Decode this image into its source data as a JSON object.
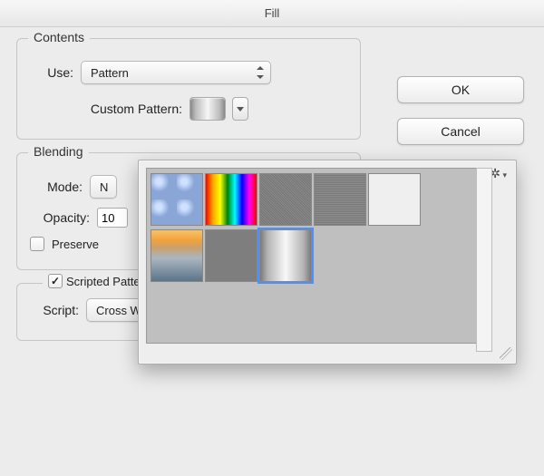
{
  "window": {
    "title": "Fill"
  },
  "buttons": {
    "ok": "OK",
    "cancel": "Cancel"
  },
  "contents": {
    "legend": "Contents",
    "use_label": "Use:",
    "use_value": "Pattern",
    "custom_pattern_label": "Custom Pattern:"
  },
  "blending": {
    "legend": "Blending",
    "mode_label": "Mode:",
    "mode_value_visible": "N",
    "opacity_label": "Opacity:",
    "opacity_value": "10",
    "preserve_label_visible": "Preserve",
    "preserve_checked": false
  },
  "scripted": {
    "checkbox_label": "Scripted Patterns",
    "checkbox_checked": true,
    "script_label": "Script:",
    "script_value": "Cross Weave"
  },
  "popover": {
    "patterns": [
      {
        "name": "bubbles",
        "selected": false
      },
      {
        "name": "rainbow-gradient",
        "selected": false
      },
      {
        "name": "noise-fine",
        "selected": false
      },
      {
        "name": "noise-coarse",
        "selected": false
      },
      {
        "name": "paper",
        "selected": false
      },
      {
        "name": "sunset-photo",
        "selected": false
      },
      {
        "name": "solid-gray",
        "selected": false
      },
      {
        "name": "metal-gradient",
        "selected": true
      }
    ]
  }
}
